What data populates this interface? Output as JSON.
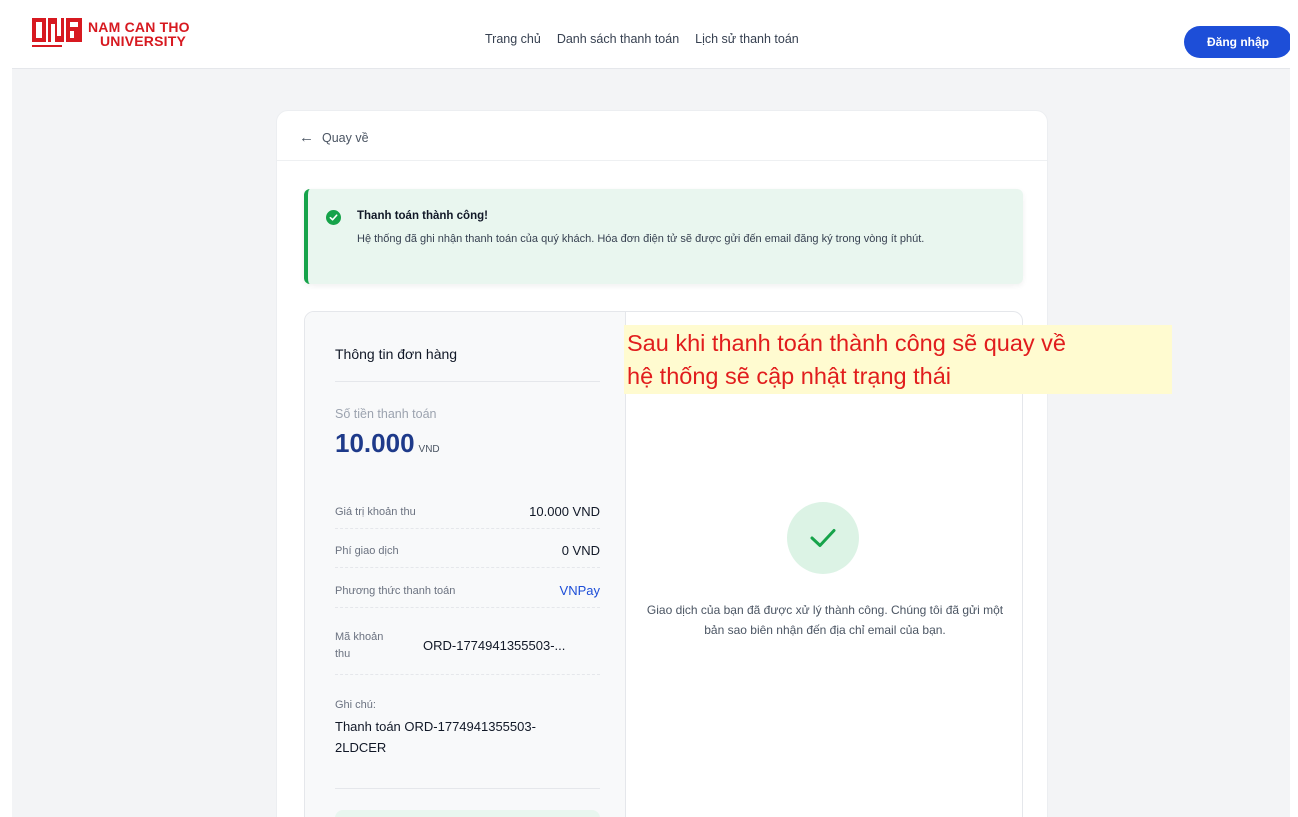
{
  "header": {
    "logo_line1": "NAM CAN THO",
    "logo_line2": "UNIVERSITY",
    "nav": [
      "Trang chủ",
      "Danh sách thanh toán",
      "Lịch sử thanh toán"
    ],
    "login_label": "Đăng nhập"
  },
  "back_label": "Quay về",
  "alert": {
    "title": "Thanh toán thành công!",
    "message": "Hệ thống đã ghi nhận thanh toán của quý khách. Hóa đơn điện tử sẽ được gửi đến email đăng ký trong vòng ít phút."
  },
  "order": {
    "title": "Thông tin đơn hàng",
    "amount_label": "Số tiền thanh toán",
    "amount": "10.000",
    "currency": "VND",
    "rows": [
      {
        "label": "Giá trị khoản thu",
        "value": "10.000 VND"
      },
      {
        "label": "Phí giao dịch",
        "value": "0 VND"
      },
      {
        "label": "Phương thức thanh toán",
        "value": "VNPay"
      },
      {
        "label": "Mã khoản thu",
        "value": "ORD-1774941355503-..."
      }
    ],
    "note_label": "Ghi chú:",
    "note": "Thanh toán ORD-1774941355503-2LDCER"
  },
  "success_message": "Giao dịch của bạn đã được xử lý thành công. Chúng tôi đã gửi một bản sao biên nhận đến địa chỉ email của bạn.",
  "annotation": {
    "line1": "Sau khi thanh toán thành công sẽ quay về",
    "line2": "hệ thống sẽ cập nhật trạng thái"
  },
  "colors": {
    "brand_red": "#d71920",
    "primary_blue": "#1d4ed8",
    "success_green": "#16a34a",
    "annotation_red": "#e11d1d"
  },
  "icons": {
    "back": "arrow-left-icon",
    "alert": "check-circle-icon",
    "success": "check-icon"
  }
}
